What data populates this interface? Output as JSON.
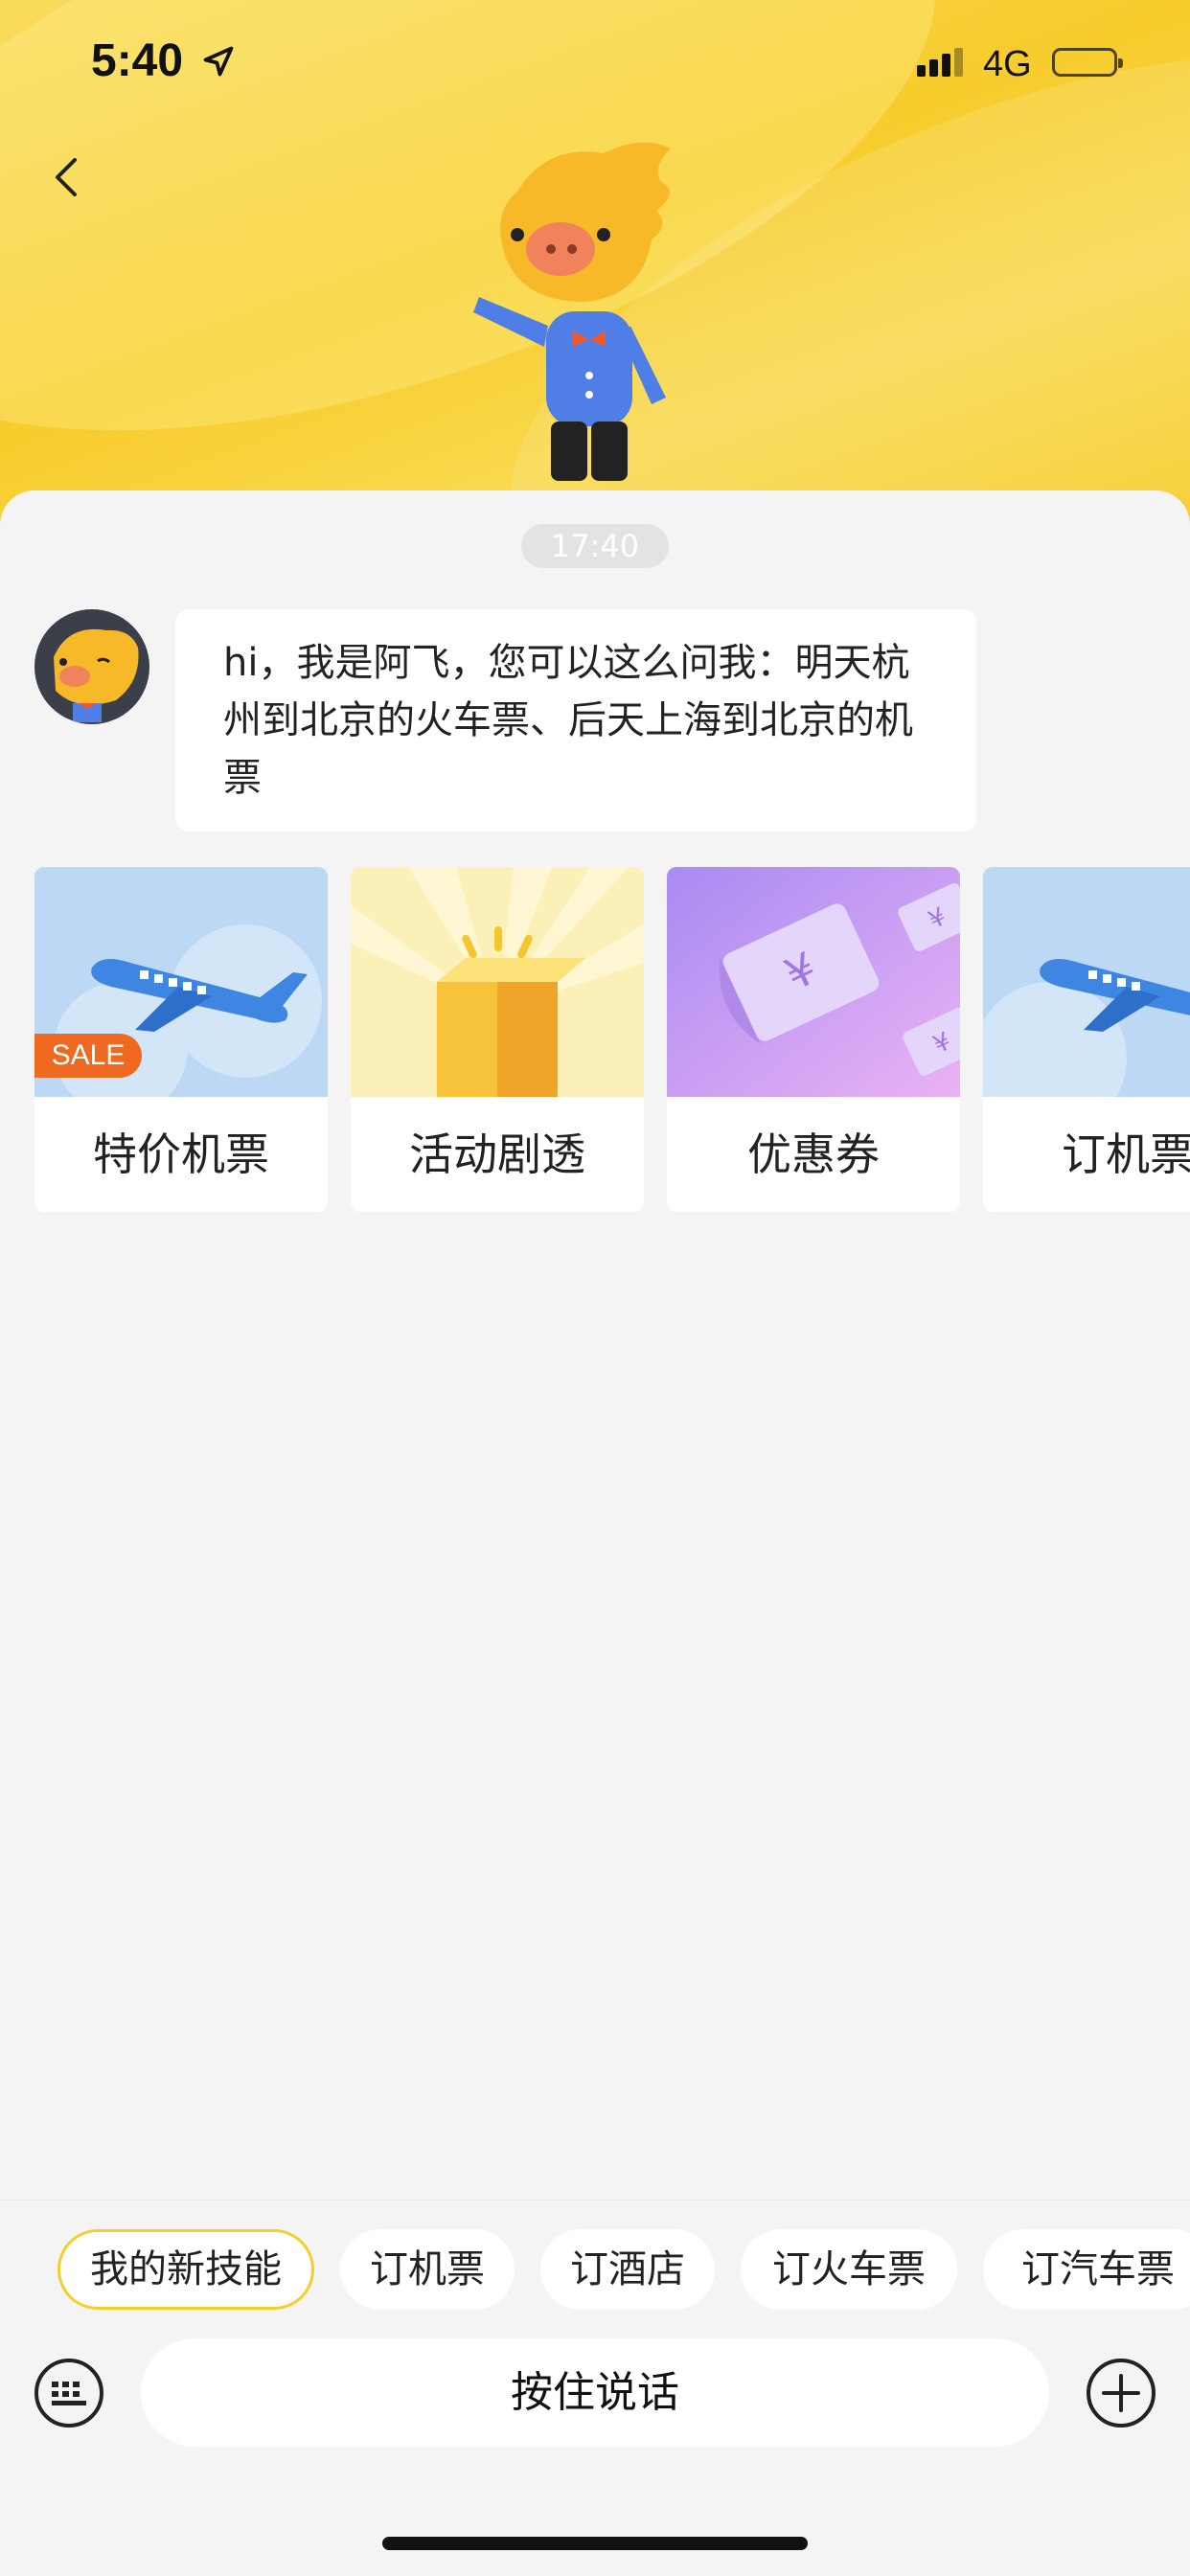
{
  "status_bar": {
    "time": "5:40",
    "network": "4G"
  },
  "chat": {
    "timestamp": "17:40",
    "bot_message": "hi，我是阿飞，您可以这么问我：明天杭州到北京的火车票、后天上海到北京的机票"
  },
  "cards": [
    {
      "label": "特价机票",
      "badge": "SALE",
      "icon": "airplane-icon"
    },
    {
      "label": "活动剧透",
      "icon": "gift-box-icon"
    },
    {
      "label": "优惠券",
      "icon": "coupon-icon"
    },
    {
      "label": "订机票",
      "icon": "airplane-icon"
    }
  ],
  "quick_chips": [
    {
      "label": "我的新技能",
      "active": true
    },
    {
      "label": "订机票"
    },
    {
      "label": "订酒店"
    },
    {
      "label": "订火车票"
    },
    {
      "label": "订汽车票"
    }
  ],
  "input": {
    "voice_label": "按住说话"
  },
  "colors": {
    "header_yellow": "#f7cc2c",
    "sale_orange": "#ef6a20",
    "chip_border": "#f4cf2c",
    "background": "#f4f4f4"
  }
}
